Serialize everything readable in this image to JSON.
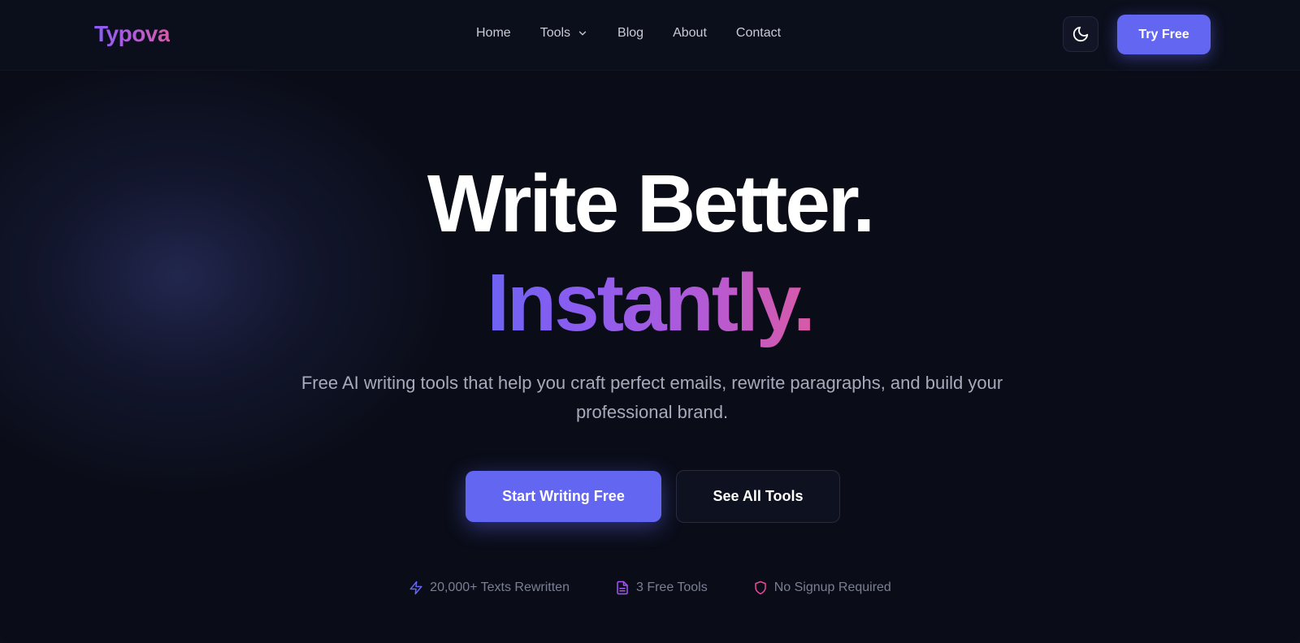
{
  "brand": {
    "logo": "Typova"
  },
  "nav": {
    "items": [
      {
        "label": "Home"
      },
      {
        "label": "Tools"
      },
      {
        "label": "Blog"
      },
      {
        "label": "About"
      },
      {
        "label": "Contact"
      }
    ]
  },
  "header": {
    "theme_toggle_icon": "moon-icon",
    "try_label": "Try Free"
  },
  "hero": {
    "line1": "Write Better.",
    "line2": "Instantly.",
    "subtitle": "Free AI writing tools that help you craft perfect emails, rewrite paragraphs, and build your professional brand.",
    "cta_primary": "Start Writing Free",
    "cta_secondary": "See All Tools"
  },
  "stats": [
    {
      "icon": "lightning-icon",
      "label": "20,000+ Texts Rewritten",
      "color": "#6366f1"
    },
    {
      "icon": "document-icon",
      "label": "3 Free Tools",
      "color": "#a855f7"
    },
    {
      "icon": "shield-icon",
      "label": "No Signup Required",
      "color": "#ec4899"
    }
  ],
  "colors": {
    "accent": "#6366f1",
    "background": "#0a0d18",
    "gradient_start": "#6d63f3",
    "gradient_end": "#d95aa6"
  }
}
